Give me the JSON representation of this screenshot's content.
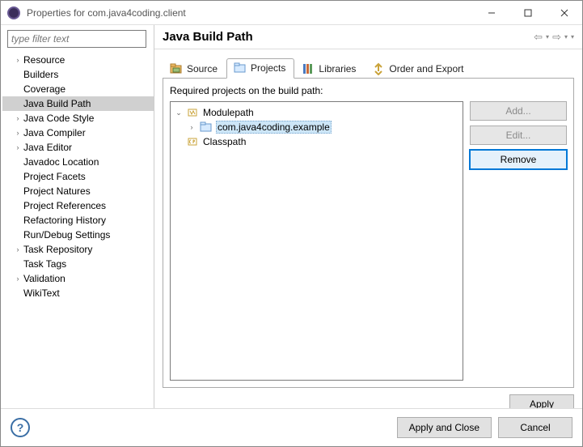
{
  "window": {
    "title": "Properties for com.java4coding.client"
  },
  "filter_placeholder": "type filter text",
  "nav_tree": [
    {
      "label": "Resource",
      "expandable": true
    },
    {
      "label": "Builders",
      "expandable": false
    },
    {
      "label": "Coverage",
      "expandable": false
    },
    {
      "label": "Java Build Path",
      "expandable": false,
      "selected": true
    },
    {
      "label": "Java Code Style",
      "expandable": true
    },
    {
      "label": "Java Compiler",
      "expandable": true
    },
    {
      "label": "Java Editor",
      "expandable": true
    },
    {
      "label": "Javadoc Location",
      "expandable": false
    },
    {
      "label": "Project Facets",
      "expandable": false
    },
    {
      "label": "Project Natures",
      "expandable": false
    },
    {
      "label": "Project References",
      "expandable": false
    },
    {
      "label": "Refactoring History",
      "expandable": false
    },
    {
      "label": "Run/Debug Settings",
      "expandable": false
    },
    {
      "label": "Task Repository",
      "expandable": true
    },
    {
      "label": "Task Tags",
      "expandable": false
    },
    {
      "label": "Validation",
      "expandable": true
    },
    {
      "label": "WikiText",
      "expandable": false
    }
  ],
  "page": {
    "title": "Java Build Path",
    "tabs": {
      "source": "Source",
      "projects": "Projects",
      "libraries": "Libraries",
      "order": "Order and Export"
    },
    "active_tab": "projects",
    "projects_caption": "Required projects on the build path:",
    "buildpath": {
      "modulepath_label": "Modulepath",
      "modulepath_items": [
        "com.java4coding.example"
      ],
      "classpath_label": "Classpath"
    },
    "buttons": {
      "add": "Add...",
      "edit": "Edit...",
      "remove": "Remove",
      "apply": "Apply"
    }
  },
  "footer": {
    "apply_close": "Apply and Close",
    "cancel": "Cancel"
  }
}
